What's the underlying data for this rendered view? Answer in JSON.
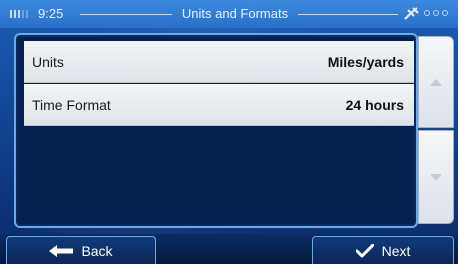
{
  "status": {
    "time": "9:25",
    "title": "Units and Formats"
  },
  "settings": [
    {
      "label": "Units",
      "value": "Miles/yards"
    },
    {
      "label": "Time Format",
      "value": "24 hours"
    }
  ],
  "buttons": {
    "back_label": "Back",
    "next_label": "Next"
  },
  "icons": {
    "battery": "battery-icon",
    "gps": "satellite-icon",
    "scroll_up": "chevron-up-icon",
    "scroll_down": "chevron-down-icon",
    "back": "arrow-left-icon",
    "next": "checkmark-icon"
  },
  "colors": {
    "accent": "#2b6fc8",
    "panel": "#06214f",
    "item": "#e8ebef"
  }
}
